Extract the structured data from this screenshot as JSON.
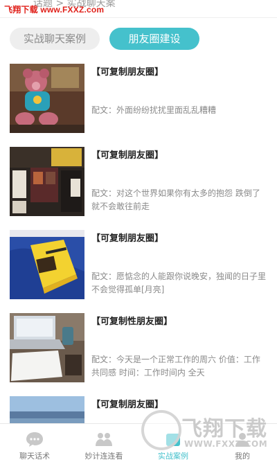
{
  "watermark": {
    "top_text": "飞翔下载 www.FXXZ.com",
    "corner_big": "飞翔下载",
    "corner_url": "WWW.FXXZ.COM"
  },
  "topbar": {
    "faded_text": "话题 > 实战聊天案"
  },
  "tabs": [
    {
      "label": "实战聊天案例",
      "active": false
    },
    {
      "label": "朋友圈建设",
      "active": true
    }
  ],
  "posts": [
    {
      "title": "【可复制朋友圈】",
      "body": "配文：外面纷纷扰扰里面乱乱糟糟",
      "thumb": "teddy-bear-photo"
    },
    {
      "title": "【可复制朋友圈】",
      "body": "配文：对这个世界如果你有太多的抱怨 跌倒了就不会敢往前走",
      "thumb": "shop-wall-photo"
    },
    {
      "title": "【可复制朋友圈】",
      "body": "配文：愿惦念的人能跟你说晚安，独闻的日子里不会觉得孤单[月亮]",
      "thumb": "book-photo"
    },
    {
      "title": "【可复制性朋友圈】",
      "body": "配文：今天是一个正常工作的周六 价值：工作 共同感 时间：工作时间内 全天",
      "thumb": "laptop-desk-photo"
    },
    {
      "title": "【可复制朋友圈】",
      "body": "",
      "thumb": "sea-photo"
    }
  ],
  "nav": [
    {
      "label": "聊天话术",
      "icon": "chat-bubble-icon",
      "active": false
    },
    {
      "label": "妙计连连看",
      "icon": "users-icon",
      "active": false
    },
    {
      "label": "实战案例",
      "icon": "case-icon",
      "active": true
    },
    {
      "label": "我的",
      "icon": "profile-icon",
      "active": false
    }
  ],
  "colors": {
    "accent": "#45c1cc",
    "watermark_red": "#e0201a",
    "muted": "#8a8a8a"
  }
}
